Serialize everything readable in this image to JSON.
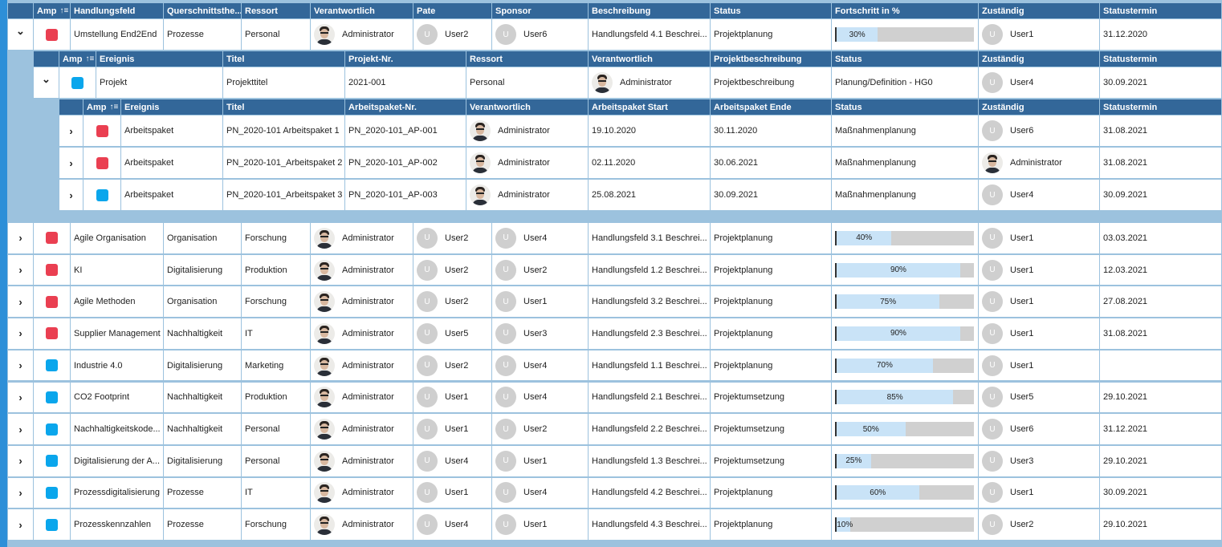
{
  "colors": {
    "red": "#ea3f51",
    "blue": "#0aa6ec",
    "header": "#336799"
  },
  "main": {
    "columns": [
      "",
      "Amp",
      "Handlungsfeld",
      "Querschnittsthe...",
      "Ressort",
      "Verantwortlich",
      "Pate",
      "Sponsor",
      "Beschreibung",
      "Status",
      "Fortschritt in %",
      "Zuständig",
      "Statustermin"
    ],
    "rows": [
      {
        "expanded": true,
        "amp": "red",
        "handlungsfeld": "Umstellung End2End",
        "querschnitt": "Prozesse",
        "ressort": "Personal",
        "verantwortlich": "Administrator",
        "pate": "User2",
        "sponsor": "User6",
        "beschreibung": "Handlungsfeld 4.1 Beschrei...",
        "status": "Projektplanung",
        "fortschritt": 30,
        "zustaendig": "User1",
        "statustermin": "31.12.2020"
      },
      {
        "expanded": false,
        "amp": "red",
        "handlungsfeld": "Agile Organisation",
        "querschnitt": "Organisation",
        "ressort": "Forschung",
        "verantwortlich": "Administrator",
        "pate": "User2",
        "sponsor": "User4",
        "beschreibung": "Handlungsfeld 3.1 Beschrei...",
        "status": "Projektplanung",
        "fortschritt": 40,
        "zustaendig": "User1",
        "statustermin": "03.03.2021"
      },
      {
        "expanded": false,
        "amp": "red",
        "handlungsfeld": "KI",
        "querschnitt": "Digitalisierung",
        "ressort": "Produktion",
        "verantwortlich": "Administrator",
        "pate": "User2",
        "sponsor": "User2",
        "beschreibung": "Handlungsfeld 1.2 Beschrei...",
        "status": "Projektplanung",
        "fortschritt": 90,
        "zustaendig": "User1",
        "statustermin": "12.03.2021"
      },
      {
        "expanded": false,
        "amp": "red",
        "handlungsfeld": "Agile Methoden",
        "querschnitt": "Organisation",
        "ressort": "Forschung",
        "verantwortlich": "Administrator",
        "pate": "User2",
        "sponsor": "User1",
        "beschreibung": "Handlungsfeld 3.2 Beschrei...",
        "status": "Projektplanung",
        "fortschritt": 75,
        "zustaendig": "User1",
        "statustermin": "27.08.2021"
      },
      {
        "expanded": false,
        "amp": "red",
        "handlungsfeld": "Supplier Management",
        "querschnitt": "Nachhaltigkeit",
        "ressort": "IT",
        "verantwortlich": "Administrator",
        "pate": "User5",
        "sponsor": "User3",
        "beschreibung": "Handlungsfeld 2.3 Beschrei...",
        "status": "Projektplanung",
        "fortschritt": 90,
        "zustaendig": "User1",
        "statustermin": "31.08.2021"
      },
      {
        "expanded": false,
        "amp": "blue",
        "handlungsfeld": "Industrie 4.0",
        "querschnitt": "Digitalisierung",
        "ressort": "Marketing",
        "verantwortlich": "Administrator",
        "pate": "User2",
        "sponsor": "User4",
        "beschreibung": "Handlungsfeld 1.1 Beschrei...",
        "status": "Projektplanung",
        "fortschritt": 70,
        "zustaendig": "User1",
        "statustermin": ""
      },
      {
        "expanded": false,
        "amp": "blue",
        "handlungsfeld": "CO2 Footprint",
        "querschnitt": "Nachhaltigkeit",
        "ressort": "Produktion",
        "verantwortlich": "Administrator",
        "pate": "User1",
        "sponsor": "User4",
        "beschreibung": "Handlungsfeld 2.1 Beschrei...",
        "status": "Projektumsetzung",
        "fortschritt": 85,
        "zustaendig": "User5",
        "statustermin": "29.10.2021"
      },
      {
        "expanded": false,
        "amp": "blue",
        "handlungsfeld": "Nachhaltigkeitskode...",
        "querschnitt": "Nachhaltigkeit",
        "ressort": "Personal",
        "verantwortlich": "Administrator",
        "pate": "User1",
        "sponsor": "User2",
        "beschreibung": "Handlungsfeld 2.2 Beschrei...",
        "status": "Projektumsetzung",
        "fortschritt": 50,
        "zustaendig": "User6",
        "statustermin": "31.12.2021"
      },
      {
        "expanded": false,
        "amp": "blue",
        "handlungsfeld": "Digitalisierung der A...",
        "querschnitt": "Digitalisierung",
        "ressort": "Personal",
        "verantwortlich": "Administrator",
        "pate": "User4",
        "sponsor": "User1",
        "beschreibung": "Handlungsfeld 1.3 Beschrei...",
        "status": "Projektumsetzung",
        "fortschritt": 25,
        "zustaendig": "User3",
        "statustermin": "29.10.2021"
      },
      {
        "expanded": false,
        "amp": "blue",
        "handlungsfeld": "Prozessdigitalisierung",
        "querschnitt": "Prozesse",
        "ressort": "IT",
        "verantwortlich": "Administrator",
        "pate": "User1",
        "sponsor": "User4",
        "beschreibung": "Handlungsfeld 4.2 Beschrei...",
        "status": "Projektplanung",
        "fortschritt": 60,
        "zustaendig": "User1",
        "statustermin": "30.09.2021"
      },
      {
        "expanded": false,
        "amp": "blue",
        "handlungsfeld": "Prozesskennzahlen",
        "querschnitt": "Prozesse",
        "ressort": "Forschung",
        "verantwortlich": "Administrator",
        "pate": "User4",
        "sponsor": "User1",
        "beschreibung": "Handlungsfeld 4.3 Beschrei...",
        "status": "Projektplanung",
        "fortschritt": 10,
        "zustaendig": "User2",
        "statustermin": "29.10.2021"
      }
    ]
  },
  "projects": {
    "columns": [
      "",
      "Amp",
      "Ereignis",
      "Titel",
      "Projekt-Nr.",
      "Ressort",
      "Verantwortlich",
      "Projektbeschreibung",
      "Status",
      "Zuständig",
      "Statustermin"
    ],
    "rows": [
      {
        "expanded": true,
        "amp": "blue",
        "ereignis": "Projekt",
        "titel": "Projekttitel",
        "nr": "2021-001",
        "ressort": "Personal",
        "verantwortlich": "Administrator",
        "beschreibung": "Projektbeschreibung",
        "status": "Planung/Definition - HG0",
        "zustaendig": "User4",
        "statustermin": "30.09.2021"
      }
    ]
  },
  "workpackages": {
    "columns": [
      "",
      "Amp",
      "Ereignis",
      "Titel",
      "Arbeitspaket-Nr.",
      "Verantwortlich",
      "Arbeitspaket Start",
      "Arbeitspaket Ende",
      "Status",
      "Zuständig",
      "Statustermin"
    ],
    "rows": [
      {
        "expanded": false,
        "amp": "red",
        "ereignis": "Arbeitspaket",
        "titel": "PN_2020-101 Arbeitspaket 1",
        "nr": "PN_2020-101_AP-001",
        "verantwortlich": "Administrator",
        "start": "19.10.2020",
        "ende": "30.11.2020",
        "status": "Maßnahmenplanung",
        "zustaendig": "User6",
        "zustaendig_admin": false,
        "statustermin": "31.08.2021"
      },
      {
        "expanded": false,
        "amp": "red",
        "ereignis": "Arbeitspaket",
        "titel": "PN_2020-101_Arbeitspaket 2",
        "nr": "PN_2020-101_AP-002",
        "verantwortlich": "Administrator",
        "start": "02.11.2020",
        "ende": "30.06.2021",
        "status": "Maßnahmenplanung",
        "zustaendig": "Administrator",
        "zustaendig_admin": true,
        "statustermin": "31.08.2021"
      },
      {
        "expanded": false,
        "amp": "blue",
        "ereignis": "Arbeitspaket",
        "titel": "PN_2020-101_Arbeitspaket 3",
        "nr": "PN_2020-101_AP-003",
        "verantwortlich": "Administrator",
        "start": "25.08.2021",
        "ende": "30.09.2021",
        "status": "Maßnahmenplanung",
        "zustaendig": "User4",
        "zustaendig_admin": false,
        "statustermin": "30.09.2021"
      }
    ]
  },
  "avatar_initial": "U"
}
